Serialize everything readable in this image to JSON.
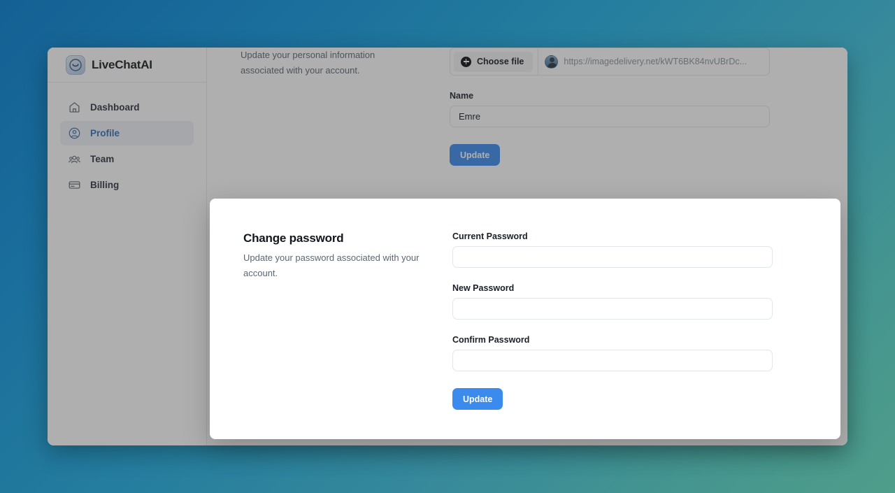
{
  "brand": {
    "name": "LiveChatAI",
    "logo_icon": "chat-smile-icon"
  },
  "sidebar": {
    "items": [
      {
        "label": "Dashboard",
        "icon": "home-icon",
        "active": false
      },
      {
        "label": "Profile",
        "icon": "user-circle-icon",
        "active": true
      },
      {
        "label": "Team",
        "icon": "users-group-icon",
        "active": false
      },
      {
        "label": "Billing",
        "icon": "credit-card-icon",
        "active": false
      }
    ]
  },
  "profile_section": {
    "description": "Update your personal information associated with your account.",
    "file_upload": {
      "choose_file_label": "Choose file",
      "plus_icon": "plus-circle-icon",
      "avatar_icon": "avatar-thumbnail",
      "url_value": "https://imagedelivery.net/kWT6BK84nvUBrDc..."
    },
    "name_label": "Name",
    "name_value": "Emre",
    "update_label": "Update"
  },
  "modal": {
    "title": "Change password",
    "description": "Update your password associated with your account.",
    "fields": [
      {
        "label": "Current Password",
        "value": "",
        "name": "current-password-input"
      },
      {
        "label": "New Password",
        "value": "",
        "name": "new-password-input"
      },
      {
        "label": "Confirm Password",
        "value": "",
        "name": "confirm-password-input"
      }
    ],
    "update_label": "Update"
  },
  "colors": {
    "accent_blue": "#3b8aee",
    "active_nav_text": "#2f6fba",
    "bg_gradient_start": "#146094",
    "bg_gradient_end": "#4f9d8a"
  }
}
